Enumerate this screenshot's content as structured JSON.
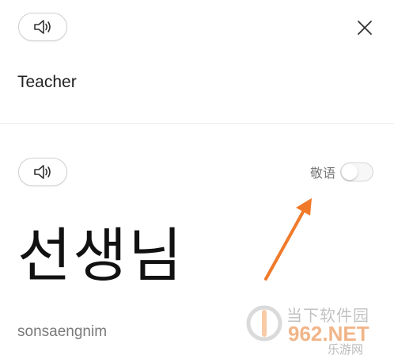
{
  "top": {
    "speaker_icon": "speaker-icon",
    "close_icon": "close-icon",
    "english_word": "Teacher"
  },
  "bottom": {
    "speaker_icon": "speaker-icon",
    "honorific_label": "敬语",
    "honorific_enabled": false,
    "korean_word": "선생님",
    "romanization": "sonsaengnim"
  },
  "annotation": {
    "arrow_color": "#f07a2a"
  },
  "watermark": {
    "line1": "当下软件园",
    "line2": "962.NET",
    "line3": "乐游网"
  },
  "colors": {
    "accent": "#f07a2a",
    "text": "#222222",
    "muted": "#777777"
  }
}
